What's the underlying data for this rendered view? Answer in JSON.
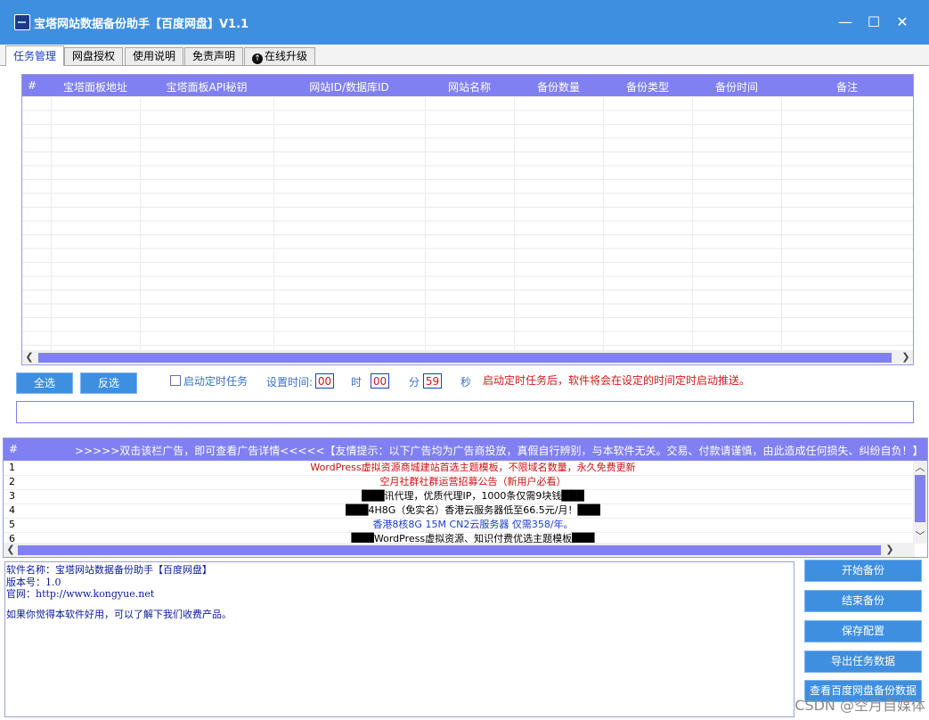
{
  "window": {
    "title": "宝塔网站数据备份助手【百度网盘】V1.1",
    "minimize": "—",
    "maximize": "☐",
    "close": "✕"
  },
  "tabs": [
    "任务管理",
    "网盘授权",
    "使用说明",
    "免责声明",
    "在线升级"
  ],
  "grid": {
    "columns": [
      "#",
      "宝塔面板地址",
      "宝塔面板API秘钥",
      "网站ID/数据库ID",
      "网站名称",
      "备份数量",
      "备份类型",
      "备份时间",
      "备注"
    ]
  },
  "controls": {
    "select_all": "全选",
    "invert": "反选",
    "schedule_label": "启动定时任务",
    "set_time_label": "设置时间:",
    "hour_value": "00",
    "hour_label": "时",
    "minute_value": "00",
    "minute_label": "分",
    "second_value": "59",
    "second_label": "秒",
    "hint": "启动定时任务后，软件将会在设定的时间定时启动推送。"
  },
  "ads": {
    "header_num": "#",
    "header_text": ">>>>>双击该栏广告，即可查看广告详情<<<<<【友情提示：以下广告均为广告商投放，真假自行辨别，与本软件无关。交易、付款请谨慎，由此造成任何损失、纠纷自负！】",
    "rows": [
      {
        "num": "1",
        "text": "WordPress虚拟资源商城建站首选主题模板，不限域名数量，永久免费更新",
        "color": "#cc1111"
      },
      {
        "num": "2",
        "text": "空月社群社群运营招募公告（新用户必看）",
        "color": "#cc1111"
      },
      {
        "num": "3",
        "text": "███讯代理，优质代理IP，1000条仅需9块钱███",
        "color": "#000000"
      },
      {
        "num": "4",
        "text": "███4H8G（免实名）香港云服务器低至66.5元/月！███",
        "color": "#000000"
      },
      {
        "num": "5",
        "text": "香港8核8G 15M CN2云服务器  仅需358/年。",
        "color": "#1a3fc4"
      },
      {
        "num": "6",
        "text": "███WordPress虚拟资源、知识付费优选主题模板███",
        "color": "#000000"
      }
    ]
  },
  "log": {
    "line1": "软件名称：宝塔网站数据备份助手【百度网盘】",
    "line2": "版本号：1.0",
    "line3": "官网：http://www.kongyue.net",
    "line4": "如果你觉得本软件好用，可以了解下我们收费产品。"
  },
  "actions": [
    "开始备份",
    "结束备份",
    "保存配置",
    "导出任务数据",
    "查看百度网盘备份数据"
  ],
  "watermark": "CSDN @空月自媒体"
}
